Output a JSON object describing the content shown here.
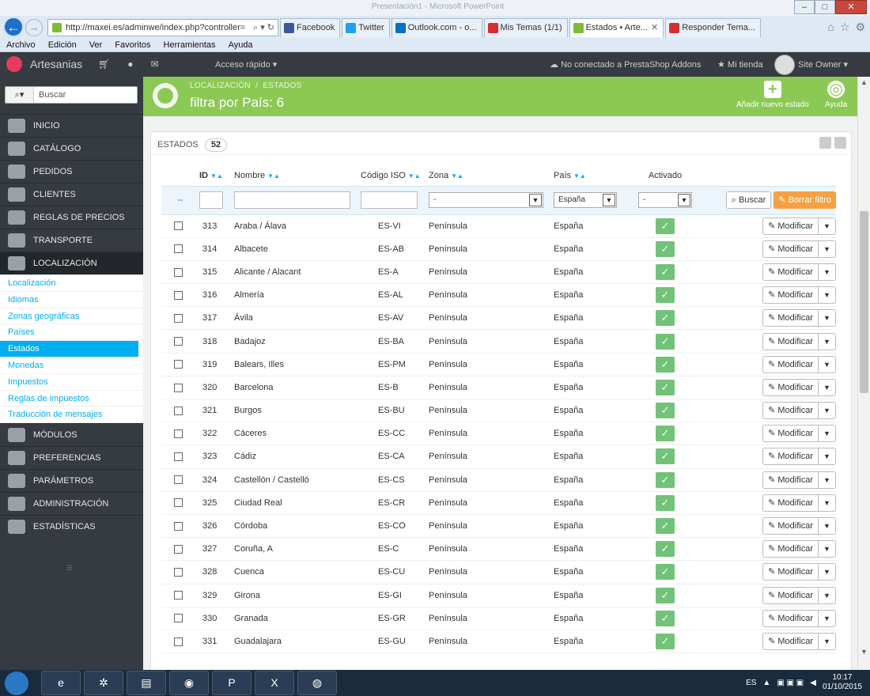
{
  "browser": {
    "window_title": "Presentación1 - Microsoft PowerPoint",
    "address": "http://maxei.es/adminwe/index.php?controller=",
    "tabs": [
      {
        "label": "Facebook",
        "color": "#3b5998",
        "icon": "facebook-icon"
      },
      {
        "label": "Twitter",
        "color": "#1da1f2",
        "icon": "twitter-icon"
      },
      {
        "label": "Outlook.com - o...",
        "color": "#0072c6",
        "icon": "outlook-icon"
      },
      {
        "label": "Mis Temas (1/1)",
        "color": "#d62d2d",
        "icon": "forum-icon"
      },
      {
        "label": "Estados • Arte...",
        "color": "#7dbb3a",
        "icon": "prestashop-icon",
        "active": true
      },
      {
        "label": "Responder Tema...",
        "color": "#d62d2d",
        "icon": "forum-icon"
      }
    ],
    "menu": [
      "Archivo",
      "Edición",
      "Ver",
      "Favoritos",
      "Herramientas",
      "Ayuda"
    ]
  },
  "topbar": {
    "shop_name": "Artesanias",
    "quick_access": "Acceso rápido ▾",
    "addons": "No conectado a PrestaShop Addons",
    "my_store": "Mi tienda",
    "owner": "Site Owner ▾"
  },
  "sidebar": {
    "search_placeholder": "Buscar",
    "items": [
      {
        "label": "Inicio"
      },
      {
        "label": "Catálogo"
      },
      {
        "label": "Pedidos"
      },
      {
        "label": "Clientes"
      },
      {
        "label": "Reglas de precios"
      },
      {
        "label": "Transporte"
      },
      {
        "label": "Localización",
        "active": true
      }
    ],
    "subitems": [
      {
        "label": "Localización"
      },
      {
        "label": "Idiomas"
      },
      {
        "label": "Zonas geográficas"
      },
      {
        "label": "Países"
      },
      {
        "label": "Estados",
        "active": true
      },
      {
        "label": "Monedas"
      },
      {
        "label": "Impuestos"
      },
      {
        "label": "Reglas de impuestos"
      },
      {
        "label": "Traducción de mensajes"
      }
    ],
    "items_after": [
      {
        "label": "Módulos"
      },
      {
        "label": "Preferencias"
      },
      {
        "label": "Parámetros avanzados"
      },
      {
        "label": "Administración"
      },
      {
        "label": "Estadísticas"
      }
    ]
  },
  "header": {
    "breadcrumb_1": "Localización",
    "breadcrumb_2": "Estados",
    "title": "filtra por País: 6",
    "add_label": "Añadir nuevo estado",
    "help_label": "Ayuda",
    "color": "#8bc954"
  },
  "panel": {
    "title": "Estados",
    "count": "52",
    "columns": {
      "id": "ID",
      "name": "Nombre",
      "iso": "Código ISO",
      "zone": "Zona",
      "country": "País",
      "active": "Activado"
    },
    "filter": {
      "dash": "--",
      "zone_value": "-",
      "country_value": "España",
      "active_value": "-",
      "search_btn": "Buscar",
      "reset_btn": "Borrar filtro"
    },
    "edit_label": "Modificar",
    "rows": [
      {
        "id": "313",
        "name": "Araba / Álava",
        "iso": "ES-VI",
        "zone": "Península",
        "country": "España"
      },
      {
        "id": "314",
        "name": "Albacete",
        "iso": "ES-AB",
        "zone": "Península",
        "country": "España"
      },
      {
        "id": "315",
        "name": "Alicante / Alacant",
        "iso": "ES-A",
        "zone": "Península",
        "country": "España"
      },
      {
        "id": "316",
        "name": "Almería",
        "iso": "ES-AL",
        "zone": "Península",
        "country": "España"
      },
      {
        "id": "317",
        "name": "Ávila",
        "iso": "ES-AV",
        "zone": "Península",
        "country": "España"
      },
      {
        "id": "318",
        "name": "Badajoz",
        "iso": "ES-BA",
        "zone": "Península",
        "country": "España"
      },
      {
        "id": "319",
        "name": "Balears, Illes",
        "iso": "ES-PM",
        "zone": "Península",
        "country": "España"
      },
      {
        "id": "320",
        "name": "Barcelona",
        "iso": "ES-B",
        "zone": "Península",
        "country": "España"
      },
      {
        "id": "321",
        "name": "Burgos",
        "iso": "ES-BU",
        "zone": "Península",
        "country": "España"
      },
      {
        "id": "322",
        "name": "Cáceres",
        "iso": "ES-CC",
        "zone": "Península",
        "country": "España"
      },
      {
        "id": "323",
        "name": "Cádiz",
        "iso": "ES-CA",
        "zone": "Península",
        "country": "España"
      },
      {
        "id": "324",
        "name": "Castellón / Castelló",
        "iso": "ES-CS",
        "zone": "Península",
        "country": "España"
      },
      {
        "id": "325",
        "name": "Ciudad Real",
        "iso": "ES-CR",
        "zone": "Península",
        "country": "España"
      },
      {
        "id": "326",
        "name": "Córdoba",
        "iso": "ES-CO",
        "zone": "Península",
        "country": "España"
      },
      {
        "id": "327",
        "name": "Coruña, A",
        "iso": "ES-C",
        "zone": "Península",
        "country": "España"
      },
      {
        "id": "328",
        "name": "Cuenca",
        "iso": "ES-CU",
        "zone": "Península",
        "country": "España"
      },
      {
        "id": "329",
        "name": "Girona",
        "iso": "ES-GI",
        "zone": "Península",
        "country": "España"
      },
      {
        "id": "330",
        "name": "Granada",
        "iso": "ES-GR",
        "zone": "Península",
        "country": "España"
      },
      {
        "id": "331",
        "name": "Guadalajara",
        "iso": "ES-GU",
        "zone": "Península",
        "country": "España"
      }
    ]
  },
  "taskbar": {
    "lang": "ES",
    "time": "10:17",
    "date": "01/10/2015"
  }
}
